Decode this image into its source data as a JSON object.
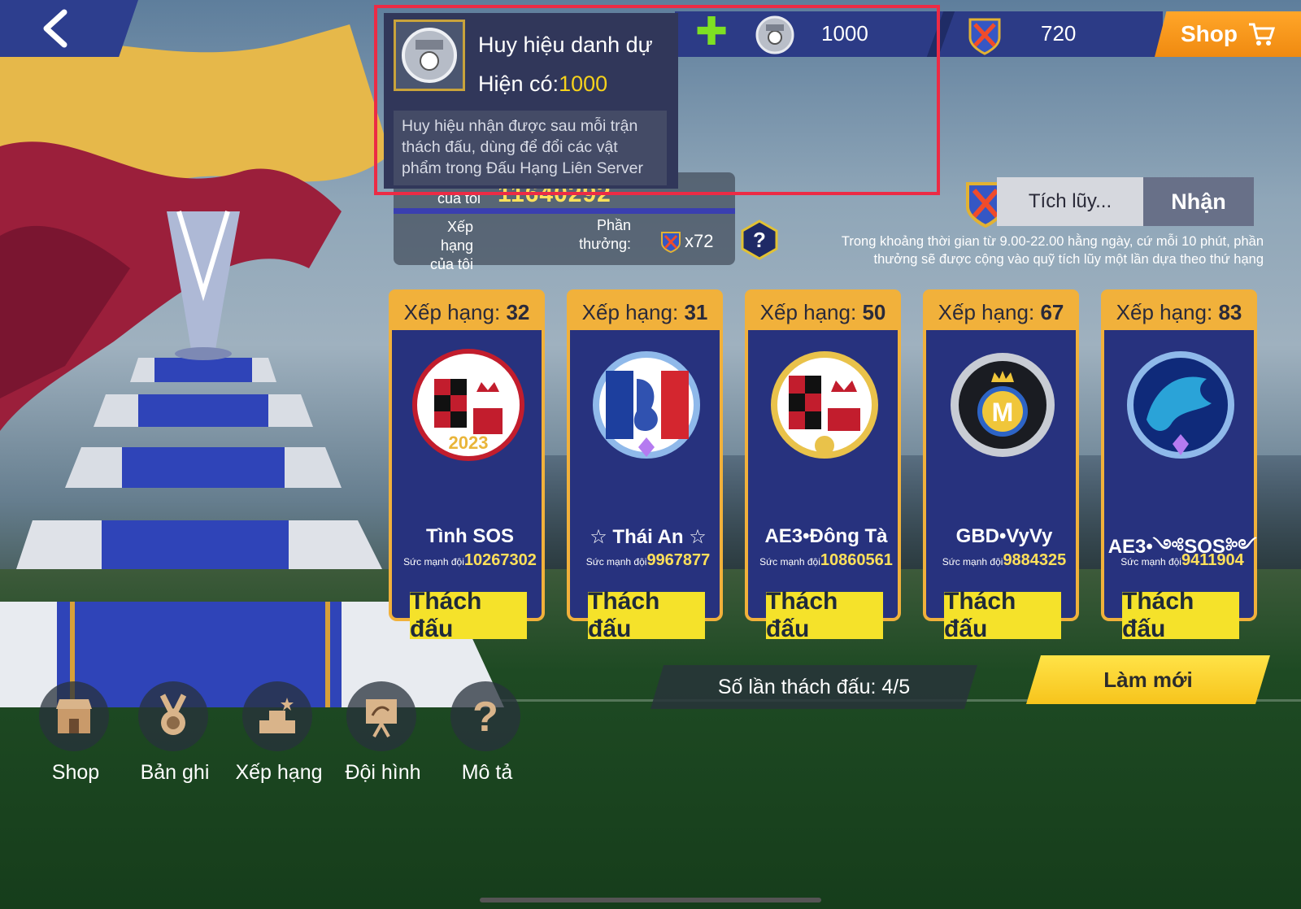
{
  "topbar": {
    "badge_count": "1000",
    "sword_count": "720",
    "shop_label": "Shop"
  },
  "tooltip": {
    "title": "Huy hiệu danh dự",
    "count_label": "Hiện có:",
    "count_value": "1000",
    "description": "Huy hiệu nhận được sau mỗi trận thách đấu, dùng để đổi các vật phẩm trong Đấu Hạng Liên Server"
  },
  "my_rank": {
    "power_label": "của tôi",
    "power_value": "11640292",
    "rank_label": "Xếp hạng của tôi",
    "reward_label": "Phần thưởng:",
    "reward_value": "x72"
  },
  "accumulate": {
    "label": "Tích lũy...",
    "button": "Nhận",
    "note": "Trong khoảng thời gian từ 9.00-22.00 hằng ngày, cứ mỗi 10 phút, phần thưởng sẽ được cộng vào quỹ tích lũy một lần dựa theo thứ hạng"
  },
  "opponents": [
    {
      "rank_label": "Xếp hạng:",
      "rank": "32",
      "name": "Tình SOS",
      "power_label": "Sức mạnh đội",
      "power": "10267302",
      "button": "Thách đấu",
      "logo": "club-crest-red-black"
    },
    {
      "rank_label": "Xếp hạng:",
      "rank": "31",
      "name": "☆ Thái An ☆",
      "power_label": "Sức mạnh đội",
      "power": "9967877",
      "button": "Thách đấu",
      "logo": "rooster-crest"
    },
    {
      "rank_label": "Xếp hạng:",
      "rank": "50",
      "name": "AE3•Đông Tà",
      "power_label": "Sức mạnh đội",
      "power": "10860561",
      "button": "Thách đấu",
      "logo": "club-crest-red-black"
    },
    {
      "rank_label": "Xếp hạng:",
      "rank": "67",
      "name": "GBD•VyVy",
      "power_label": "Sức mạnh đội",
      "power": "9884325",
      "button": "Thách đấu",
      "logo": "crown-m-crest"
    },
    {
      "rank_label": "Xếp hạng:",
      "rank": "83",
      "name": "AE3•༺SOS༻",
      "power_label": "Sức mạnh đội",
      "power": "9411904",
      "button": "Thách đấu",
      "logo": "wolf-crest"
    }
  ],
  "challenge_count": "Số lần thách đấu: 4/5",
  "refresh_button": "Làm mới",
  "nav": [
    {
      "label": "Shop",
      "icon": "shop-icon"
    },
    {
      "label": "Bản ghi",
      "icon": "medal-icon"
    },
    {
      "label": "Xếp hạng",
      "icon": "podium-icon"
    },
    {
      "label": "Đội hình",
      "icon": "tactics-board-icon"
    },
    {
      "label": "Mô tả",
      "icon": "question-icon"
    }
  ],
  "colors": {
    "accent_orange": "#f08a10",
    "highlight_red": "#ec2b45",
    "card_gold": "#f1b13b",
    "button_yellow": "#f5e22a",
    "power_yellow": "#ffe05a"
  }
}
